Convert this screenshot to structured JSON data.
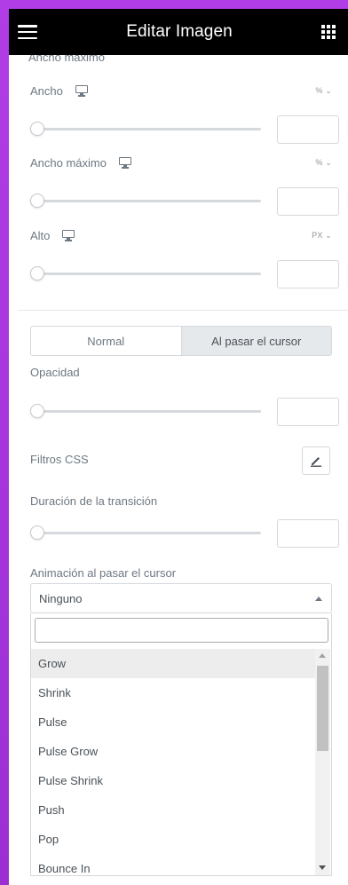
{
  "header": {
    "title": "Editar Imagen",
    "menu_icon": "hamburger-icon",
    "apps_icon": "grid-icon"
  },
  "cutoff_label": "Ancho máximo",
  "controls": {
    "width": {
      "label": "Ancho",
      "unit": "% ⌄",
      "device_icon": "desktop-icon",
      "value": ""
    },
    "max_width": {
      "label": "Ancho máximo",
      "unit": "% ⌄",
      "device_icon": "desktop-icon",
      "value": ""
    },
    "height": {
      "label": "Alto",
      "unit": "PX ⌄",
      "device_icon": "desktop-icon",
      "value": ""
    },
    "opacity": {
      "label": "Opacidad",
      "value": ""
    },
    "css_filters": {
      "label": "Filtros CSS",
      "edit_icon": "pencil-icon"
    },
    "transition": {
      "label": "Duración de la transición",
      "value": ""
    },
    "hover_animation": {
      "label": "Animación al pasar el cursor",
      "selected": "Ninguno"
    }
  },
  "tabs": [
    {
      "label": "Normal",
      "active": false
    },
    {
      "label": "Al pasar el cursor",
      "active": true
    }
  ],
  "dropdown": {
    "search_value": "",
    "options": [
      "Grow",
      "Shrink",
      "Pulse",
      "Pulse Grow",
      "Pulse Shrink",
      "Push",
      "Pop",
      "Bounce In"
    ],
    "highlighted": "Grow"
  },
  "colors": {
    "background": "#a834de",
    "topbar": "#000000",
    "text": "#6d7882",
    "active_tab": "#e6e9ec"
  }
}
